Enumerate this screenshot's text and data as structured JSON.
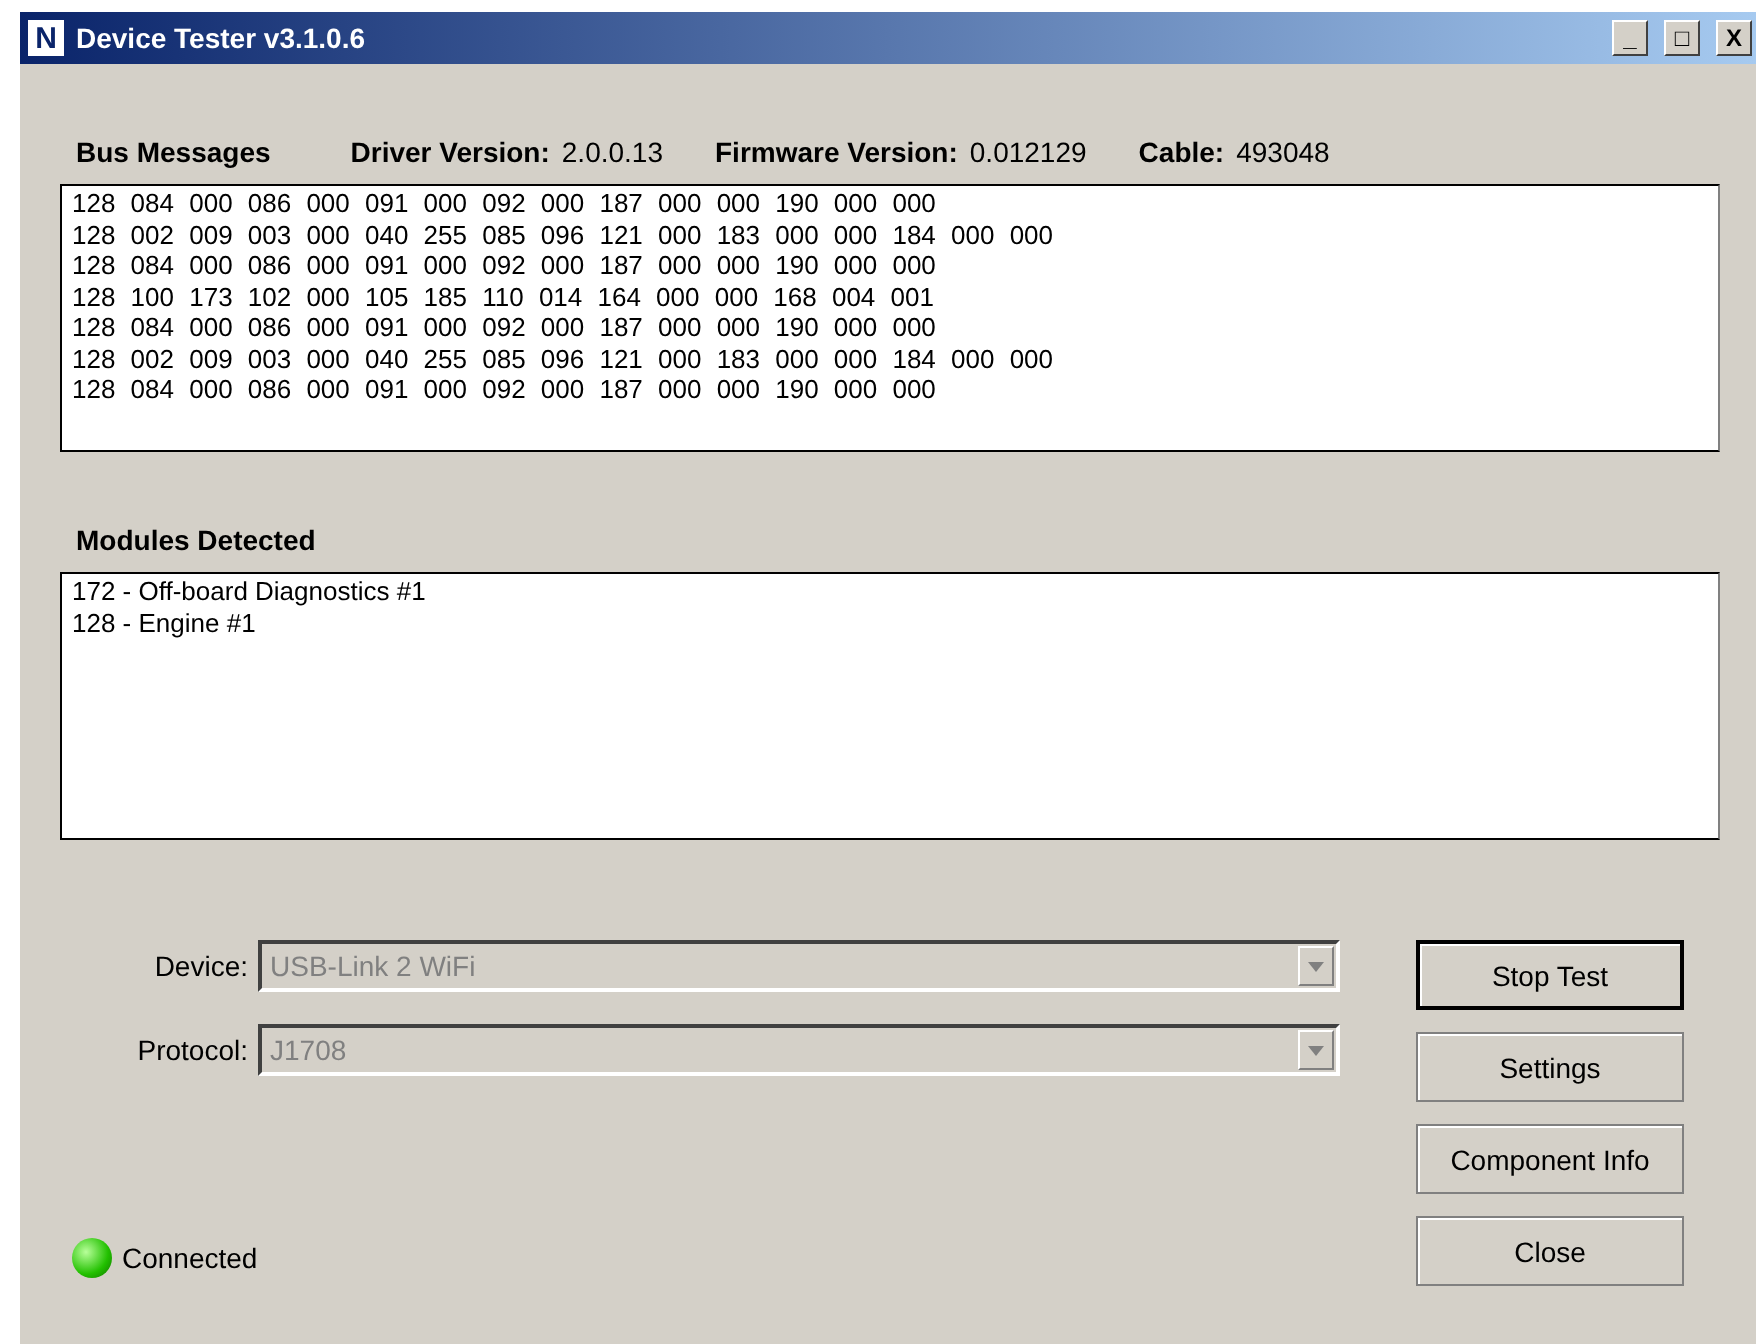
{
  "window": {
    "title": "Device Tester  v3.1.0.6",
    "app_icon_letter": "N",
    "controls": [
      "_",
      "□",
      "X"
    ]
  },
  "bus_messages": {
    "heading": "Bus Messages",
    "info": [
      {
        "label": "Driver Version:",
        "value": "2.0.0.13"
      },
      {
        "label": "Firmware Version:",
        "value": "0.012129"
      },
      {
        "label": "Cable:",
        "value": "493048"
      }
    ],
    "lines": [
      "128 084 000 086 000 091 000 092 000 187 000 000 190 000 000",
      "128 002 009 003 000 040 255 085 096 121 000 183 000 000 184 000 000",
      "128 084 000 086 000 091 000 092 000 187 000 000 190 000 000",
      "128 100 173 102 000 105 185 110 014 164 000 000 168 004 001",
      "128 084 000 086 000 091 000 092 000 187 000 000 190 000 000",
      "128 002 009 003 000 040 255 085 096 121 000 183 000 000 184 000 000",
      "128 084 000 086 000 091 000 092 000 187 000 000 190 000 000"
    ]
  },
  "modules": {
    "heading": "Modules Detected",
    "items": [
      "172 - Off-board Diagnostics #1",
      "128 - Engine #1"
    ]
  },
  "fields": [
    {
      "label": "Device:",
      "value": "USB-Link 2 WiFi",
      "disabled": true
    },
    {
      "label": "Protocol:",
      "value": "J1708",
      "disabled": true
    }
  ],
  "buttons": [
    {
      "label": "Stop Test",
      "default": true
    },
    {
      "label": "Settings",
      "default": false
    },
    {
      "label": "Component Info",
      "default": false
    },
    {
      "label": "Close",
      "default": false
    }
  ],
  "status": {
    "label": "Connected",
    "on": true
  }
}
